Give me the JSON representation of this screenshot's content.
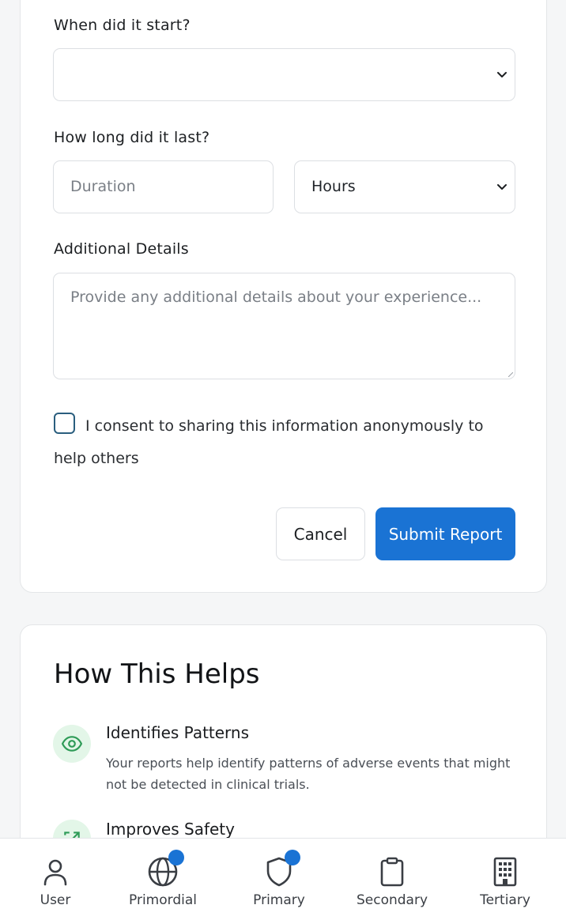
{
  "form": {
    "start_label": "When did it start?",
    "start_value": "",
    "duration_label": "How long did it last?",
    "duration_placeholder": "Duration",
    "duration_unit": "Hours",
    "details_label": "Additional Details",
    "details_placeholder": "Provide any additional details about your experience...",
    "consent_text": "I consent to sharing this information anonymously to help others",
    "cancel_label": "Cancel",
    "submit_label": "Submit Report"
  },
  "help": {
    "title": "How This Helps",
    "items": [
      {
        "title": "Identifies Patterns",
        "description": "Your reports help identify patterns of adverse events that might not be detected in clinical trials.",
        "icon": "eye-icon"
      },
      {
        "title": "Improves Safety",
        "description": "",
        "icon": "external-link-icon"
      }
    ]
  },
  "nav": {
    "items": [
      {
        "label": "User",
        "icon": "user-icon",
        "badge": false
      },
      {
        "label": "Primordial",
        "icon": "globe-icon",
        "badge": true
      },
      {
        "label": "Primary",
        "icon": "shield-icon",
        "badge": true
      },
      {
        "label": "Secondary",
        "icon": "clipboard-icon",
        "badge": false
      },
      {
        "label": "Tertiary",
        "icon": "building-icon",
        "badge": false
      }
    ]
  },
  "colors": {
    "accent": "#1a73d4",
    "help_icon_bg": "#e3f6e8",
    "help_icon_fg": "#2e9b57",
    "checkbox_border": "#2a5e7e"
  }
}
